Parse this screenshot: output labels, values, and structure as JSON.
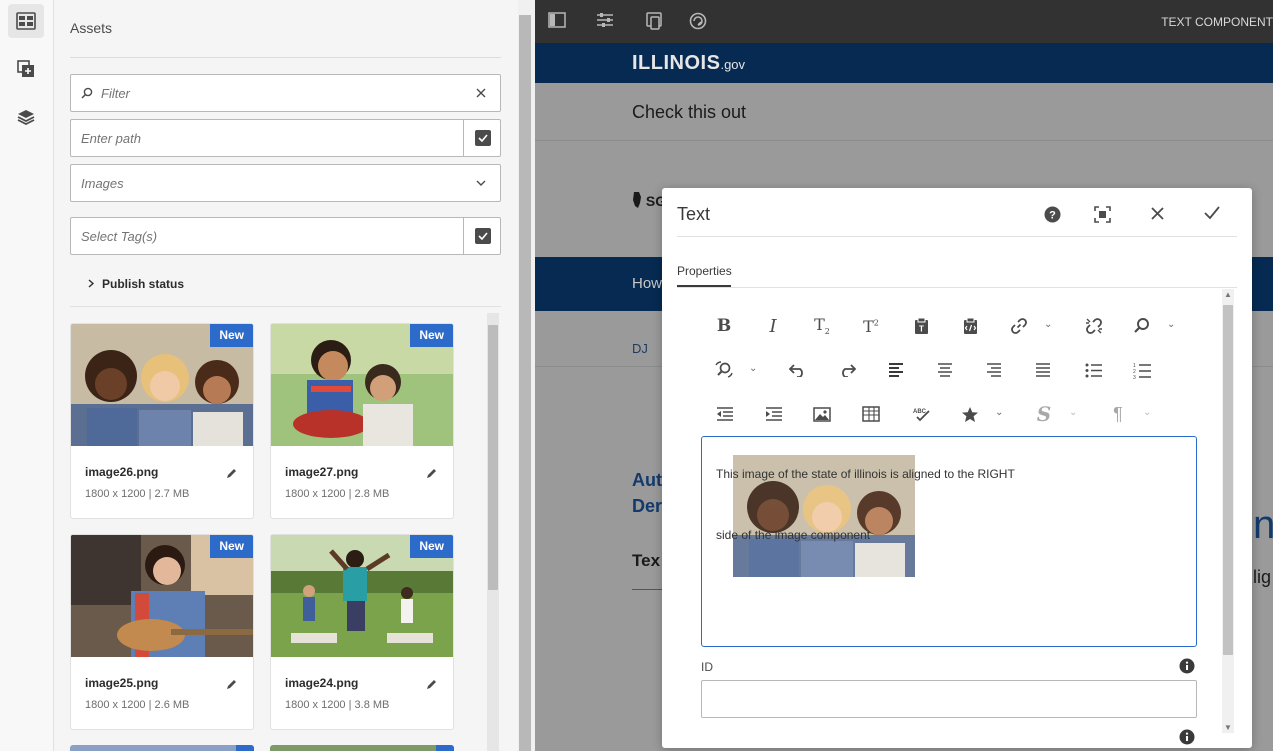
{
  "rail": {
    "items": [
      {
        "name": "assets-finder-icon",
        "active": true
      },
      {
        "name": "components-icon",
        "active": false
      },
      {
        "name": "content-tree-icon",
        "active": false
      }
    ]
  },
  "assets": {
    "title": "Assets",
    "filter_placeholder": "Filter",
    "path_placeholder": "Enter path",
    "type_value": "Images",
    "tags_placeholder": "Select Tag(s)",
    "publish_status": "Publish status",
    "badge": "New",
    "cards": [
      {
        "name": "image26.png",
        "meta": "1800 x 1200 | 2.7 MB"
      },
      {
        "name": "image27.png",
        "meta": "1800 x 1200 | 2.8 MB"
      },
      {
        "name": "image25.png",
        "meta": "1800 x 1200 | 2.6 MB"
      },
      {
        "name": "image24.png",
        "meta": "1800 x 1200 | 3.8 MB"
      }
    ]
  },
  "editor": {
    "topbar_label": "TEXT COMPONENT",
    "logo": "ILLINOIS",
    "logo_suffix": ".gov",
    "heading": "Check this out",
    "sg": "SG",
    "nav_partial": "How",
    "breadcrumb_partial": "DJ",
    "aut_line1": "Aut",
    "aut_line2": "Der",
    "tex": "Tex",
    "big_letter": "n",
    "lig": "lig"
  },
  "dialog": {
    "title": "Text",
    "tab": "Properties",
    "text_line1": "This image of the state of illinois is aligned to the RIGHT",
    "text_line2": "side of the image component",
    "id_label": "ID",
    "id_value": ""
  },
  "colors": {
    "accent": "#2d6bcb",
    "navy": "#062a52",
    "topbar": "#323232"
  }
}
